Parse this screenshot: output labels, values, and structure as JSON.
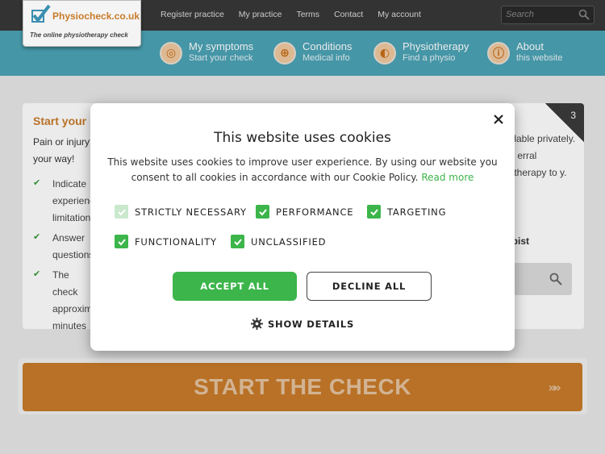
{
  "header": {
    "logo_name": "Physiocheck.co.uk",
    "logo_tagline": "The online physiotherapy check",
    "links": [
      "Register practice",
      "My practice",
      "Terms",
      "Contact",
      "My account"
    ],
    "search_placeholder": "Search"
  },
  "nav": {
    "items": [
      {
        "title": "My symptoms",
        "subtitle": "Start your check",
        "icon": "target-icon"
      },
      {
        "title": "Conditions",
        "subtitle": "Medical info",
        "icon": "plus-icon"
      },
      {
        "title": "Physiotherapy",
        "subtitle": "Find a physio",
        "icon": "physio-icon"
      },
      {
        "title": "About",
        "subtitle": "this website",
        "icon": "info-icon"
      }
    ]
  },
  "background": {
    "intro_title": "Start your",
    "intro_text": "Pain or injury? your way!",
    "bullets": [
      "Indicate experience limitation",
      "Answer questions",
      "The check approxim minutes"
    ],
    "right_text": "ailable privately. In erral iotherapy to y.",
    "right_bold": "apist",
    "step_number": "3"
  },
  "start": {
    "label": "START THE CHECK",
    "arrows": "»»"
  },
  "cookie": {
    "title": "This website uses cookies",
    "description": "This website uses cookies to improve user experience. By using our website you consent to all cookies in accordance with our Cookie Policy.",
    "read_more": "Read more",
    "options": {
      "strictly_necessary": "STRICTLY NECESSARY",
      "performance": "PERFORMANCE",
      "targeting": "TARGETING",
      "functionality": "FUNCTIONALITY",
      "unclassified": "UNCLASSIFIED"
    },
    "accept_label": "ACCEPT ALL",
    "decline_label": "DECLINE ALL",
    "details_label": "SHOW DETAILS"
  },
  "colors": {
    "accent_green": "#3cb54a",
    "brand_orange": "#c87b2a",
    "nav_teal": "#4ba3b6",
    "topbar": "#383838"
  }
}
